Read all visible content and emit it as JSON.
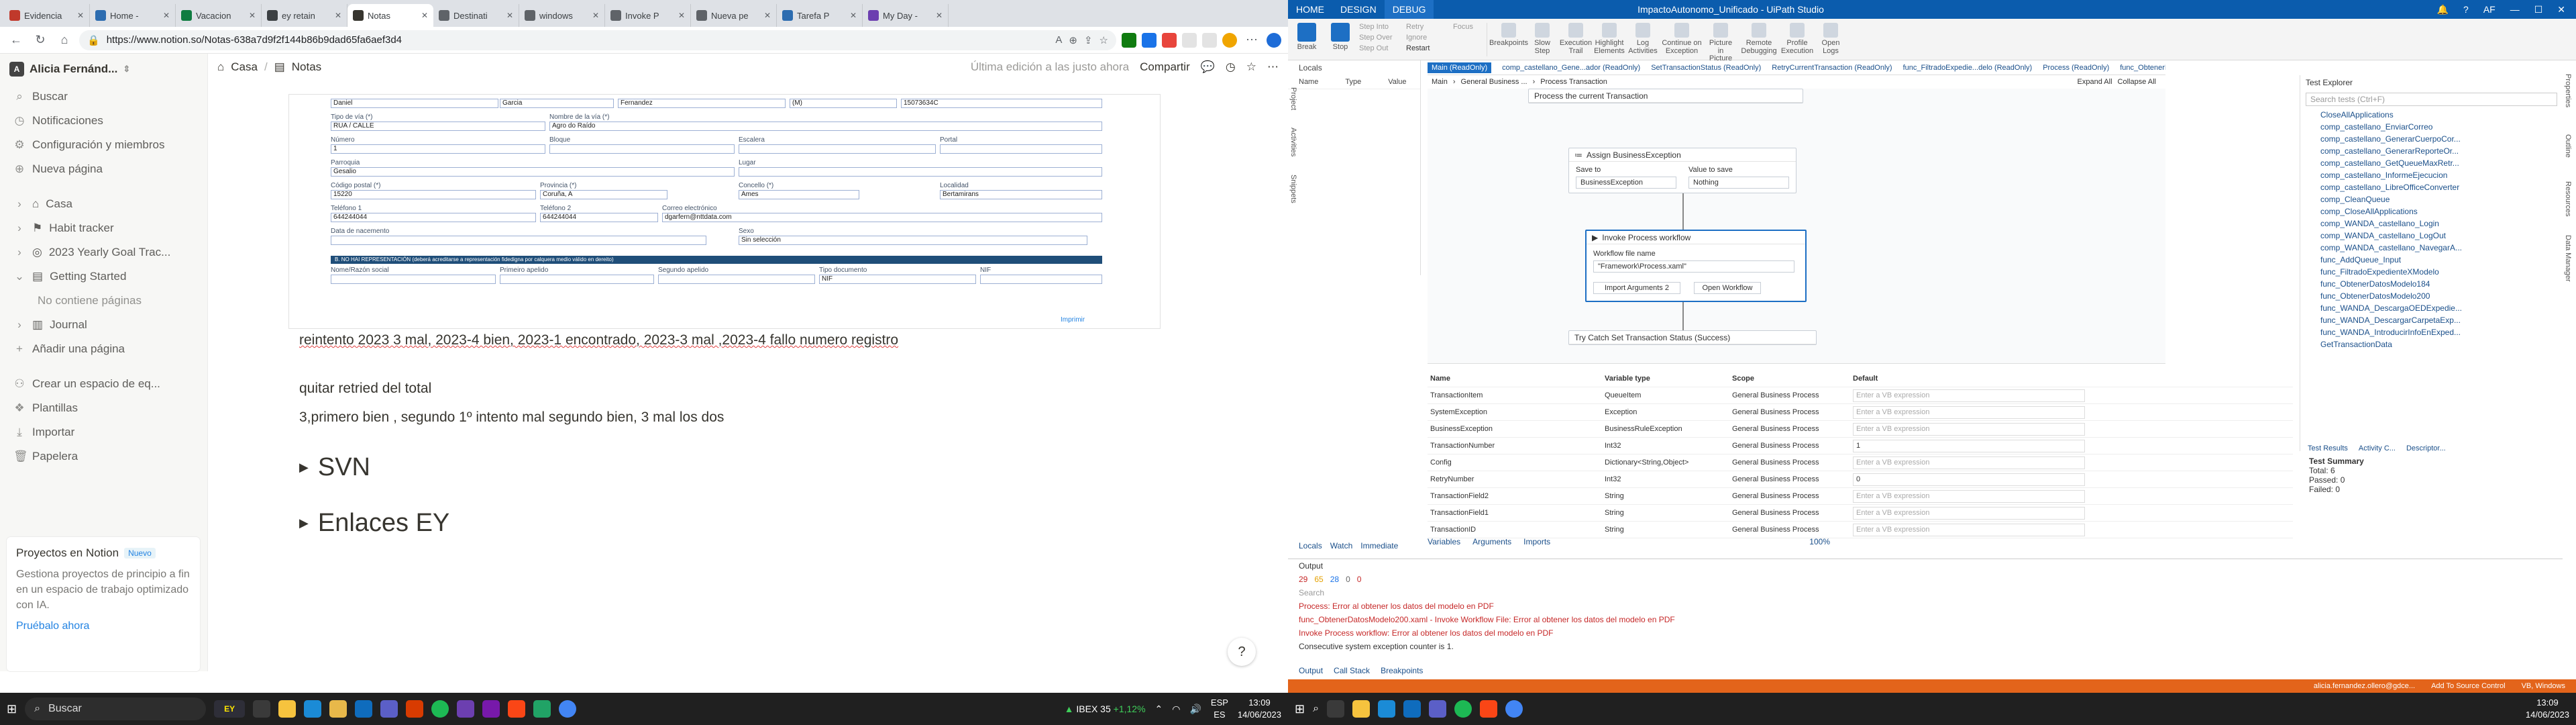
{
  "browser": {
    "tabs": [
      {
        "label": "Evidencia",
        "color": "#c0392b"
      },
      {
        "label": "Home - ",
        "color": "#2c6cb0"
      },
      {
        "label": "Vacacion",
        "color": "#107c41"
      },
      {
        "label": "ey retain",
        "color": "#3c4043"
      },
      {
        "label": "Notas",
        "color": "#37352f"
      },
      {
        "label": "Destinati",
        "color": "#5f6368"
      },
      {
        "label": "windows",
        "color": "#5f6368"
      },
      {
        "label": "Invoke P",
        "color": "#5f6368"
      },
      {
        "label": "Nueva pe",
        "color": "#5f6368"
      },
      {
        "label": "Tarefa P",
        "color": "#2c6cb0"
      },
      {
        "label": "My Day - ",
        "color": "#6c3fb0"
      }
    ],
    "url": "https://www.notion.so/Notas-638a7d9f2f144b86b9dad65fa6aef3d4"
  },
  "notion": {
    "workspace": "Alicia Fernánd...",
    "workspace_initial": "A",
    "nav": [
      "Buscar",
      "Notificaciones",
      "Configuración y miembros",
      "Nueva página"
    ],
    "pages": [
      "Casa",
      "Habit tracker",
      "2023 Yearly Goal Trac...",
      "Getting Started",
      "No contiene páginas",
      "Journal",
      "Añadir una página"
    ],
    "tools": [
      "Crear un espacio de eq...",
      "Plantillas",
      "Importar",
      "Papelera"
    ],
    "promo": {
      "title": "Proyectos en Notion",
      "badge": "Nuevo",
      "body": "Gestiona proyectos de principio a fin en un espacio de trabajo optimizado con IA.",
      "cta": "Pruébalo ahora"
    },
    "topbar": {
      "crumb1": "Casa",
      "crumb2": "Notas",
      "edited": "Última edición a las justo ahora",
      "share": "Compartir"
    },
    "form": {
      "r1": [
        "Daniel",
        "Garcia",
        "Fernandez",
        "(M)",
        "15073634C"
      ],
      "l2": [
        "Tipo de vía (*)",
        "Nombre de la vía (*)"
      ],
      "r2": [
        "RUA / CALLE",
        "Agro do Raído"
      ],
      "l3": [
        "Número",
        "Bloque",
        "Escalera",
        "Portal"
      ],
      "r3": [
        "1"
      ],
      "l4": [
        "Parroquia",
        "Lugar"
      ],
      "r4": [
        "Gesalio"
      ],
      "l5": [
        "Código postal (*)",
        "Provincia (*)",
        "Concello (*)",
        "Localidad"
      ],
      "r5": [
        "15220",
        "Coruña, A",
        "Ames",
        "Bertamirans"
      ],
      "l6": [
        "Teléfono 1",
        "Teléfono 2",
        "Correo electrónico"
      ],
      "r6": [
        "644244044",
        "644244044",
        "dgarfern@nttdata.com"
      ],
      "l7": [
        "Data de nacemento",
        "Sexo"
      ],
      "r7": [
        "Sin selección"
      ],
      "bar": "B. NO HAI REPRESENTACIÓN (deberá acreditarse a representación fidedigna por calquera medio válido en dereito)",
      "l8": [
        "Nome/Razón social",
        "Primeiro apelido",
        "Segundo apelido",
        "Tipo documento",
        "NIF"
      ],
      "r8": [
        "NIF"
      ],
      "footer": "Imprimir"
    },
    "paragraphs": [
      "reintento 2023 3 mal, 2023-4 bien, 2023-1 encontrado, 2023-3 mal ,2023-4 fallo numero registro",
      "quitar retried del total",
      "3,primero bien , segundo 1º intento mal segundo bien, 3 mal los dos"
    ],
    "toggles": [
      "SVN",
      "Enlaces EY"
    ],
    "help": "?"
  },
  "taskbar": {
    "search": "Buscar",
    "ibex": "IBEX 35",
    "ibex_change": "+1,12%",
    "lang": "ESP",
    "lang2": "ES",
    "time": "13:09",
    "date": "14/06/2023",
    "corp": "EY"
  },
  "uipath": {
    "tabs": [
      "HOME",
      "DESIGN",
      "DEBUG"
    ],
    "title": "ImpactoAutonomo_Unificado - UiPath Studio",
    "user_initials": "AF",
    "ribbon": [
      {
        "label": "Break",
        "big": true
      },
      {
        "label": "Stop",
        "big": true
      },
      {
        "label": "Breakpoints"
      },
      {
        "label": "Slow Step"
      },
      {
        "label": "Execution Trail"
      },
      {
        "label": "Highlight Elements"
      },
      {
        "label": "Log Activities"
      },
      {
        "label": "Continue on Exception"
      },
      {
        "label": "Picture in Picture"
      },
      {
        "label": "Remote Debugging"
      },
      {
        "label": "Profile Execution"
      },
      {
        "label": "Open Logs"
      }
    ],
    "step_col1": [
      "Step Into",
      "Step Over",
      "Step Out"
    ],
    "step_col2": [
      "Retry",
      "Ignore",
      "Restart"
    ],
    "focus": "Focus",
    "locals_title": "Locals",
    "locals_cols": [
      "Name",
      "Type",
      "Value"
    ],
    "side_labels": [
      "Project",
      "Activities",
      "Snippets"
    ],
    "wf_tabs": [
      "Main (ReadOnly)",
      "comp_castellano_Gene...ador (ReadOnly)",
      "SetTransactionStatus (ReadOnly)",
      "RetryCurrentTransaction (ReadOnly)",
      "func_FiltradoExpedie...delo (ReadOnly)",
      "Process (ReadOnly)",
      "func_ObtenerDa"
    ],
    "crumbs": [
      "Main",
      "General Business ...",
      "Process Transaction"
    ],
    "expand": "Expand All",
    "collapse": "Collapse All",
    "act_top": "Process the current Transaction",
    "assign": {
      "title": "Assign BusinessException",
      "save_to": "Save to",
      "value": "Value to save",
      "var": "BusinessException",
      "val": "Nothing"
    },
    "invoke": {
      "title": "Invoke Process workflow",
      "file_label": "Workflow file name",
      "file": "\"Framework\\Process.xaml\"",
      "import": "Import Arguments",
      "count": "2",
      "open": "Open Workflow"
    },
    "trycatch": "Try Catch Set Transaction Status (Success)",
    "var_cols": [
      "Name",
      "Variable type",
      "Scope",
      "Default"
    ],
    "variables": [
      [
        "TransactionItem",
        "QueueItem",
        "General Business Process",
        "Enter a VB expression"
      ],
      [
        "SystemException",
        "Exception",
        "General Business Process",
        "Enter a VB expression"
      ],
      [
        "BusinessException",
        "BusinessRuleException",
        "General Business Process",
        "Enter a VB expression"
      ],
      [
        "TransactionNumber",
        "Int32",
        "General Business Process",
        "1"
      ],
      [
        "Config",
        "Dictionary<String,Object>",
        "General Business Process",
        "Enter a VB expression"
      ],
      [
        "RetryNumber",
        "Int32",
        "General Business Process",
        "0"
      ],
      [
        "TransactionField2",
        "String",
        "General Business Process",
        "Enter a VB expression"
      ],
      [
        "TransactionField1",
        "String",
        "General Business Process",
        "Enter a VB expression"
      ],
      [
        "TransactionID",
        "String",
        "General Business Process",
        "Enter a VB expression"
      ]
    ],
    "var_tabs": [
      "Variables",
      "Arguments",
      "Imports"
    ],
    "locals_tabs": [
      "Locals",
      "Watch",
      "Immediate"
    ],
    "zoom": "100%",
    "output_title": "Output",
    "output_counts": [
      "29",
      "65",
      "28",
      "0",
      "0"
    ],
    "output_search": "Search",
    "output_lines": [
      "Process: Error al obtener los datos del modelo en PDF",
      "func_ObtenerDatosModelo200.xaml - Invoke Workflow File: Error al obtener los datos del modelo en PDF",
      "Invoke Process workflow: Error al obtener los datos del modelo en PDF",
      "Consecutive system exception counter is 1."
    ],
    "output_tabs": [
      "Output",
      "Call Stack",
      "Breakpoints"
    ],
    "test_explorer": "Test Explorer",
    "test_search": "Search tests (Ctrl+F)",
    "tests": [
      "CloseAllApplications",
      "comp_castellano_EnviarCorreo",
      "comp_castellano_GenerarCuerpoCor...",
      "comp_castellano_GenerarReporteOr...",
      "comp_castellano_GetQueueMaxRetr...",
      "comp_castellano_InformeEjecucion",
      "comp_castellano_LibreOfficeConverter",
      "comp_CleanQueue",
      "comp_CloseAllApplications",
      "comp_WANDA_castellano_Login",
      "comp_WANDA_castellano_LogOut",
      "comp_WANDA_castellano_NavegarA...",
      "func_AddQueue_Input",
      "func_FiltradoExpedienteXModelo",
      "func_ObtenerDatosModelo184",
      "func_ObtenerDatosModelo200",
      "func_WANDA_DescargaOEDExpedie...",
      "func_WANDA_DescargarCarpetaExp...",
      "func_WANDA_IntroducirInfoEnExped...",
      "GetTransactionData"
    ],
    "test_tabs": [
      "Test Results",
      "Activity C...",
      "Descriptor..."
    ],
    "right_vert": [
      "Properties",
      "Outline",
      "Resources",
      "Data Manager"
    ],
    "test_summary": {
      "title": "Test Summary",
      "total": "Total: 6",
      "passed": "Passed: 0",
      "failed": "Failed: 0"
    },
    "status": {
      "user": "alicia.fernandez.ollero@gdce...",
      "source": "Add To Source Control",
      "repo": "VB, Windows"
    }
  }
}
